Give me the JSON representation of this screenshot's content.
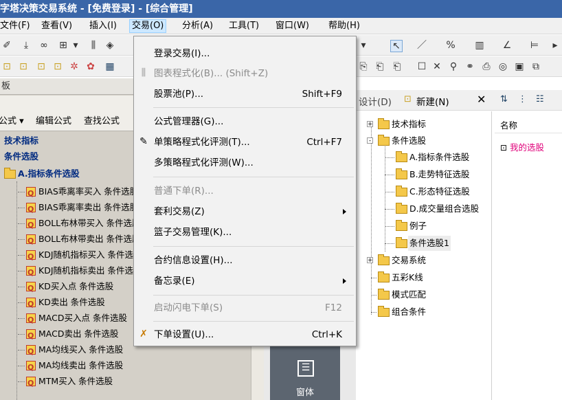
{
  "titlebar": {
    "title": "金字塔决策交易系统 - [免费登录] - [综合管理]"
  },
  "menubar": {
    "items": [
      {
        "label": "文件(F)"
      },
      {
        "label": "查看(V)"
      },
      {
        "label": "插入(I)"
      },
      {
        "label": "交易(O)"
      },
      {
        "label": "分析(A)"
      },
      {
        "label": "工具(T)"
      },
      {
        "label": "窗口(W)"
      },
      {
        "label": "帮助(H)"
      }
    ]
  },
  "left_panel": {
    "title": "板",
    "sub_actions": [
      "公式",
      "编辑公式",
      "查找公式"
    ],
    "tree": [
      {
        "label": "技术指标",
        "bold": true
      },
      {
        "label": "条件选股",
        "bold": true
      },
      {
        "label": "A.指标条件选股",
        "bold": true
      },
      {
        "label": "BIAS乖离率买入 条件选股"
      },
      {
        "label": "BIAS乖离率卖出 条件选股"
      },
      {
        "label": "BOLL布林带买入 条件选股"
      },
      {
        "label": "BOLL布林带卖出 条件选股"
      },
      {
        "label": "KDJ随机指标买入 条件选股"
      },
      {
        "label": "KDJ随机指标卖出 条件选股"
      },
      {
        "label": "KD买入点 条件选股"
      },
      {
        "label": "KD卖出 条件选股"
      },
      {
        "label": "MACD买入点 条件选股"
      },
      {
        "label": "MACD卖出 条件选股"
      },
      {
        "label": "MA均线买入 条件选股"
      },
      {
        "label": "MA均线卖出 条件选股"
      },
      {
        "label": "MTM买入 条件选股"
      }
    ]
  },
  "center": {
    "window_label": "窗体"
  },
  "right_toolbar": {
    "design_label": "设计(D)",
    "new_label": "新建(N)"
  },
  "mid_tree": [
    {
      "label": "技术指标",
      "level": 0,
      "expander": "+"
    },
    {
      "label": "条件选股",
      "level": 0,
      "expander": "-"
    },
    {
      "label": "A.指标条件选股",
      "level": 1
    },
    {
      "label": "B.走势特征选股",
      "level": 1
    },
    {
      "label": "C.形态特征选股",
      "level": 1
    },
    {
      "label": "D.成交量组合选股",
      "level": 1
    },
    {
      "label": "例子",
      "level": 1
    },
    {
      "label": "条件选股1",
      "level": 1,
      "selected": true
    },
    {
      "label": "交易系统",
      "level": 0,
      "expander": "+"
    },
    {
      "label": "五彩K线",
      "level": 0
    },
    {
      "label": "模式匹配",
      "level": 0
    },
    {
      "label": "组合条件",
      "level": 0
    }
  ],
  "right_list": {
    "header": "名称",
    "item": "我的选股"
  },
  "dropdown": {
    "items": [
      {
        "label": "登录交易(I)...",
        "shortcut": "",
        "disabled": false
      },
      {
        "label": "图表程式化(B)... (Shift+Z)",
        "shortcut": "",
        "disabled": true
      },
      {
        "label": "股票池(P)...",
        "shortcut": "Shift+F9",
        "disabled": false
      },
      {
        "label": "公式管理器(G)...",
        "shortcut": "",
        "disabled": false
      },
      {
        "label": "单策略程式化评测(T)...",
        "shortcut": "Ctrl+F7",
        "disabled": false
      },
      {
        "label": "多策略程式化评测(W)...",
        "shortcut": "",
        "disabled": false
      },
      {
        "label": "普通下单(R)...",
        "shortcut": "",
        "disabled": true
      },
      {
        "label": "套利交易(Z)",
        "shortcut": "",
        "disabled": false
      },
      {
        "label": "篮子交易管理(K)...",
        "shortcut": "",
        "disabled": false
      },
      {
        "label": "合约信息设置(H)...",
        "shortcut": "",
        "disabled": false
      },
      {
        "label": "备忘录(E)",
        "shortcut": "",
        "disabled": false
      },
      {
        "label": "启动闪电下单(S)",
        "shortcut": "F12",
        "disabled": true
      },
      {
        "label": "下单设置(U)...",
        "shortcut": "Ctrl+K",
        "disabled": false
      }
    ]
  },
  "colors": {
    "accent": "#3a66a8",
    "menu_highlight": "#cde8ff",
    "link_pink": "#e0007a"
  }
}
